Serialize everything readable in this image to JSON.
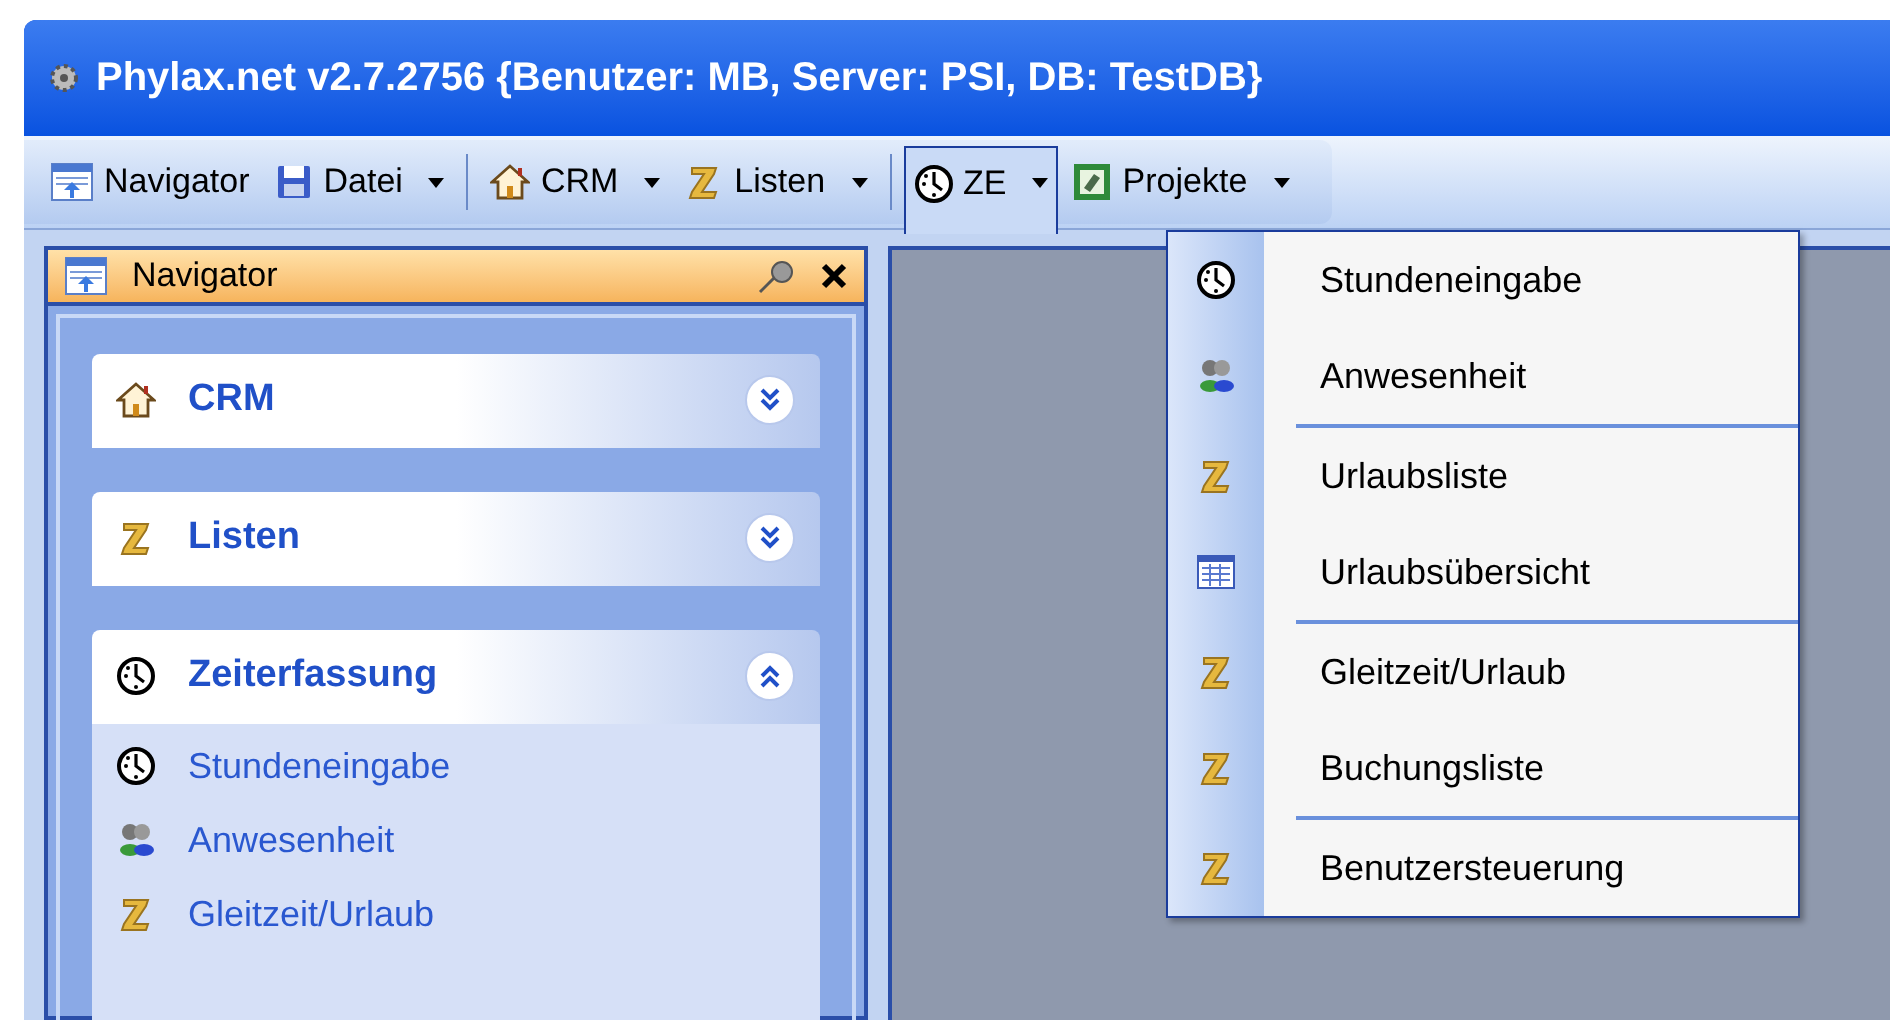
{
  "window": {
    "title": "Phylax.net v2.7.2756 {Benutzer: MB, Server: PSI, DB: TestDB}"
  },
  "toolbar": {
    "groups": [
      [
        {
          "label": "Navigator",
          "dropdown": false,
          "selected": false
        },
        {
          "label": "Datei",
          "dropdown": true,
          "selected": false
        }
      ],
      [
        {
          "label": "CRM",
          "dropdown": true,
          "selected": false
        },
        {
          "label": "Listen",
          "dropdown": true,
          "selected": false
        }
      ],
      [
        {
          "label": "ZE",
          "dropdown": true,
          "selected": true
        },
        {
          "label": "Projekte",
          "dropdown": true,
          "selected": false
        }
      ]
    ]
  },
  "navigator": {
    "title": "Navigator",
    "sections": [
      {
        "title": "CRM",
        "expanded": false
      },
      {
        "title": "Listen",
        "expanded": false
      },
      {
        "title": "Zeiterfassung",
        "expanded": true,
        "items": [
          "Stundeneingabe",
          "Anwesenheit",
          "Gleitzeit/Urlaub"
        ]
      }
    ]
  },
  "menu": {
    "groups": [
      [
        "Stundeneingabe",
        "Anwesenheit"
      ],
      [
        "Urlaubsliste",
        "Urlaubsübersicht"
      ],
      [
        "Gleitzeit/Urlaub",
        "Buchungsliste"
      ],
      [
        "Benutzersteuerung"
      ]
    ]
  }
}
